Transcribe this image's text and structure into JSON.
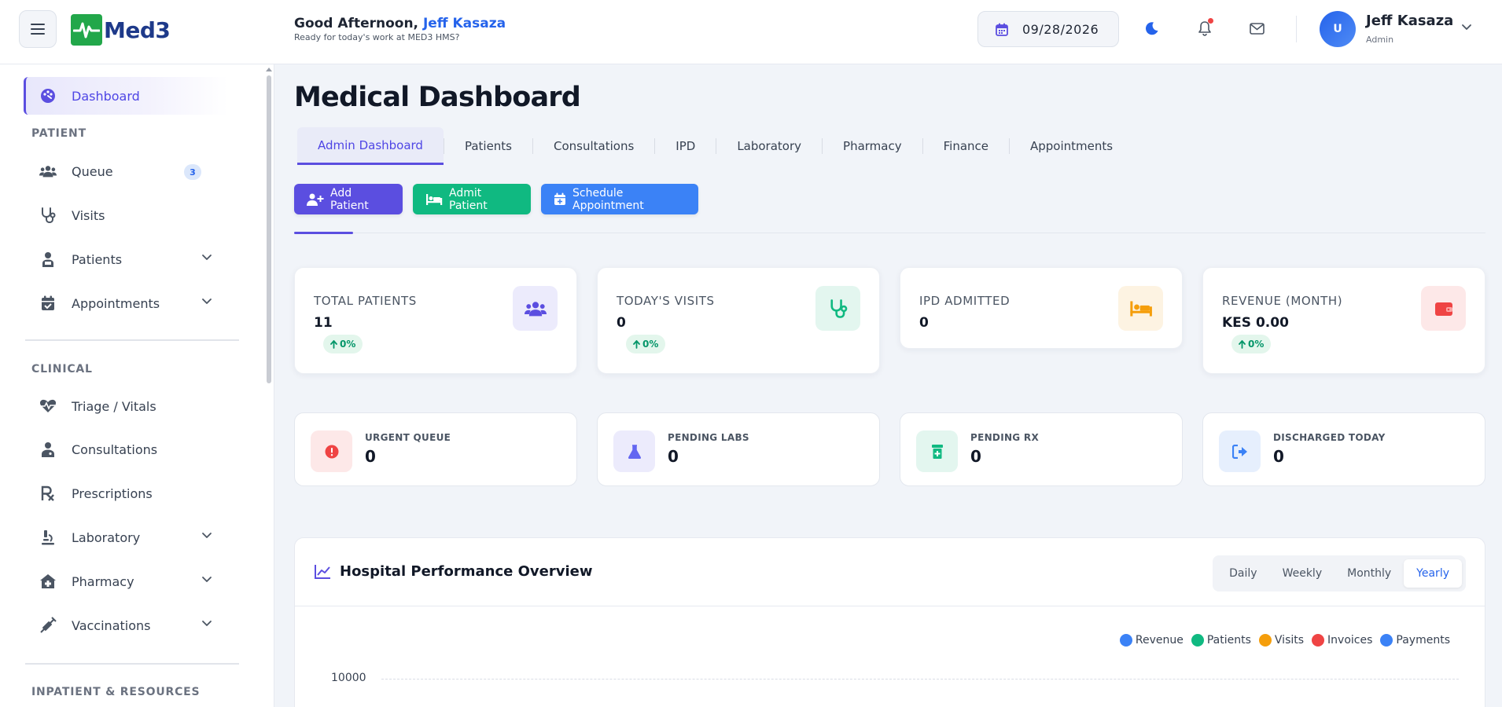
{
  "header": {
    "logo_text": "Med3",
    "greeting_prefix": "Good Afternoon, ",
    "user_first_last": "Jeff Kasaza",
    "subtitle": "Ready for today's work at MED3 HMS?",
    "date": "09/28/2026",
    "avatar_initial": "U",
    "user_name": "Jeff Kasaza",
    "user_role": "Admin"
  },
  "sidebar": {
    "items": [
      {
        "label": "Dashboard",
        "icon": "palette-icon",
        "active": true
      },
      {
        "label": "Queue",
        "icon": "users-icon",
        "badge": "3"
      },
      {
        "label": "Visits",
        "icon": "stethoscope-icon"
      },
      {
        "label": "Patients",
        "icon": "patient-icon",
        "expandable": true
      },
      {
        "label": "Appointments",
        "icon": "calendar-check-icon",
        "expandable": true
      },
      {
        "label": "Triage / Vitals",
        "icon": "heartbeat-icon"
      },
      {
        "label": "Consultations",
        "icon": "doctor-icon"
      },
      {
        "label": "Prescriptions",
        "icon": "rx-icon"
      },
      {
        "label": "Laboratory",
        "icon": "microscope-icon",
        "expandable": true
      },
      {
        "label": "Pharmacy",
        "icon": "clinic-medical-icon",
        "expandable": true
      },
      {
        "label": "Vaccinations",
        "icon": "syringe-icon",
        "expandable": true
      }
    ],
    "sections": {
      "patient": "PATIENT",
      "clinical": "CLINICAL",
      "inpatient": "INPATIENT & RESOURCES"
    }
  },
  "main": {
    "title": "Medical Dashboard",
    "tabs": [
      {
        "label": "Admin Dashboard",
        "active": true
      },
      {
        "label": "Patients"
      },
      {
        "label": "Consultations"
      },
      {
        "label": "IPD"
      },
      {
        "label": "Laboratory"
      },
      {
        "label": "Pharmacy"
      },
      {
        "label": "Finance"
      },
      {
        "label": "Appointments"
      }
    ],
    "actions": {
      "add_patient": "Add Patient",
      "admit_patient": "Admit Patient",
      "schedule_appointment": "Schedule Appointment"
    },
    "stats": [
      {
        "title": "TOTAL PATIENTS",
        "value": "11",
        "delta": "0%",
        "color": "#5b4ee0"
      },
      {
        "title": "TODAY'S VISITS",
        "value": "0",
        "delta": "0%",
        "color": "#10b981"
      },
      {
        "title": "IPD ADMITTED",
        "value": "0",
        "color": "#f59e0b"
      },
      {
        "title": "REVENUE (MONTH)",
        "value": "KES 0.00",
        "delta": "0%",
        "color": "#ef4444"
      }
    ],
    "mini_stats": [
      {
        "title": "URGENT QUEUE",
        "value": "0",
        "color": "#ef4444"
      },
      {
        "title": "PENDING LABS",
        "value": "0",
        "color": "#6366f1"
      },
      {
        "title": "PENDING RX",
        "value": "0",
        "color": "#10b981"
      },
      {
        "title": "DISCHARGED TODAY",
        "value": "0",
        "color": "#3b82f6"
      }
    ],
    "performance": {
      "title": "Hospital Performance Overview",
      "periods": [
        "Daily",
        "Weekly",
        "Monthly",
        "Yearly"
      ],
      "active_period": "Yearly"
    }
  },
  "chart_data": {
    "type": "line",
    "series": [
      {
        "name": "Revenue",
        "color": "#3b82f6",
        "values": []
      },
      {
        "name": "Patients",
        "color": "#10b981",
        "values": []
      },
      {
        "name": "Visits",
        "color": "#f59e0b",
        "values": []
      },
      {
        "name": "Invoices",
        "color": "#ef4444",
        "values": []
      },
      {
        "name": "Payments",
        "color": "#3b82f6",
        "values": []
      }
    ],
    "y_ticks": [
      "10000"
    ],
    "legend": "top-right",
    "grid": true
  }
}
